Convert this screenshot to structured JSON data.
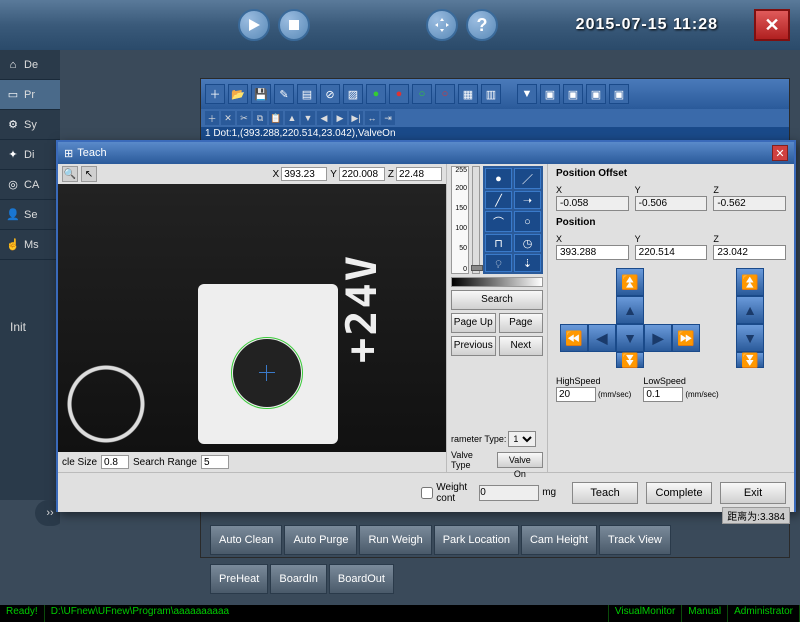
{
  "header": {
    "play_tip": "Play",
    "stop_tip": "Stop",
    "move_tip": "Move",
    "help_tip": "Help",
    "datetime": "2015-07-15  11:28"
  },
  "sidebar": {
    "items": [
      {
        "icon": "home",
        "label": "De"
      },
      {
        "icon": "monitor",
        "label": "Pr"
      },
      {
        "icon": "gear",
        "label": "Sy"
      },
      {
        "icon": "wrench",
        "label": "Di"
      },
      {
        "icon": "target",
        "label": "CA"
      },
      {
        "icon": "user",
        "label": "Se"
      },
      {
        "icon": "hand",
        "label": "Ms"
      }
    ],
    "init_label": "Init"
  },
  "editor": {
    "program_line_1": "1 Dot:1,(393.288,220.514,23.042),ValveOn"
  },
  "teach": {
    "title": "Teach",
    "coords": {
      "x_label": "X",
      "y_label": "Y",
      "z_label": "Z",
      "x": "393.23",
      "y": "220.008",
      "z": "22.48"
    },
    "mid": {
      "scale_top": "255",
      "scale_200": "200",
      "scale_150": "150",
      "scale_100": "100",
      "scale_50": "50",
      "scale_0": "0",
      "search": "Search",
      "pageup": "Page Up",
      "pagedown": "Page Down",
      "previous": "Previous",
      "next": "Next",
      "param_type_label": "rameter Type:",
      "param_type_value": "1",
      "valve_type_label": "Valve Type",
      "valve_btn": "Valve On"
    },
    "right": {
      "offset_title": "Position Offset",
      "offset_x_label": "X",
      "offset_y_label": "Y",
      "offset_z_label": "Z",
      "offset_x": "-0.058",
      "offset_y": "-0.506",
      "offset_z": "-0.562",
      "pos_title": "Position",
      "pos_x_label": "X",
      "pos_y_label": "Y",
      "pos_z_label": "Z",
      "pos_x": "393.288",
      "pos_y": "220.514",
      "pos_z": "23.042",
      "highspeed_label": "HighSpeed",
      "highspeed": "20",
      "lowspeed_label": "LowSpeed",
      "lowspeed": "0.1",
      "unit": "(mm/sec)"
    },
    "footer": {
      "circlesize_label": "cle Size",
      "circlesize": "0.8",
      "searchrange_label": "Search Range",
      "searchrange": "5",
      "weight_label": "Weight cont",
      "weight_val": "0",
      "weight_unit": "mg",
      "teach_btn": "Teach",
      "complete_btn": "Complete",
      "exit_btn": "Exit",
      "distance": "距离为:3.384"
    },
    "camera_label": "+24V"
  },
  "button_bars": {
    "a": [
      "Auto Clean",
      "Auto Purge",
      "Run Weigh",
      "Park Location",
      "Cam Height",
      "Track View"
    ],
    "b": [
      "PreHeat",
      "BoardIn",
      "BoardOut"
    ]
  },
  "status": {
    "ready": "Ready!",
    "path": "D:\\UFnew\\UFnew\\Program\\aaaaaaaaaa",
    "mode": "VisualMonitor",
    "manual": "Manual",
    "user": "Administrator"
  }
}
